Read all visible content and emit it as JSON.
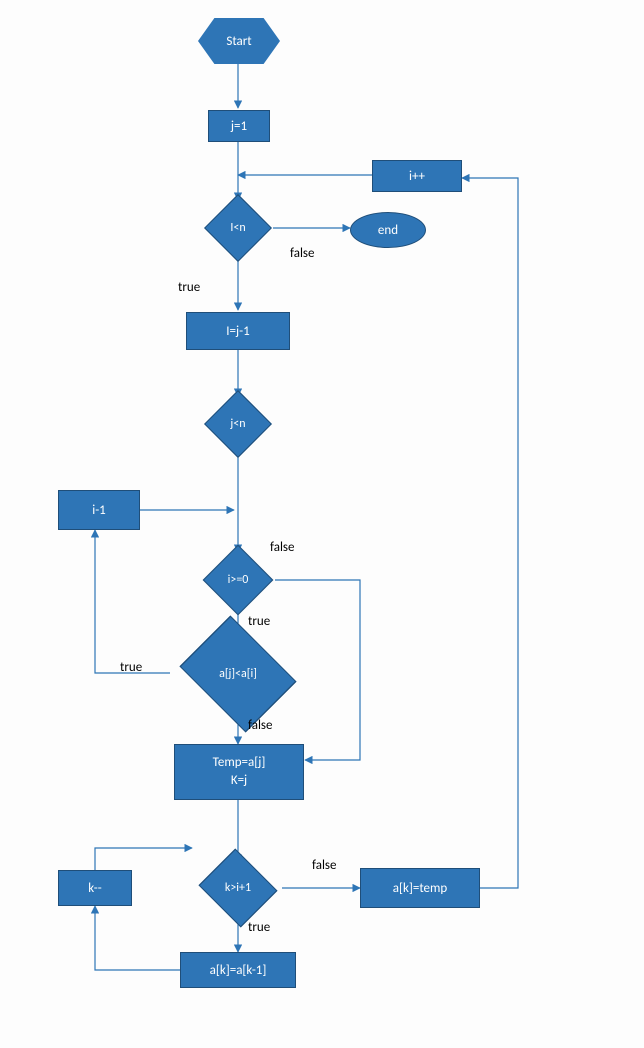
{
  "nodes": {
    "start": "Start",
    "init_j": "j=1",
    "inc_i": "i++",
    "cond_I_lt_n": "I<n",
    "end": "end",
    "set_I": "I=j-1",
    "cond_j_lt_n": "j<n",
    "i_minus_1": "i-1",
    "cond_i_ge_0": "i>=0",
    "cond_aj_lt_ai": "a[j]<a[i]",
    "temp_line1": "Temp=a[j]",
    "temp_line2": "K=j",
    "cond_k_gt_i1": "k>i+1",
    "ak_eq_temp": "a[k]=temp",
    "k_dec": "k--",
    "ak_eq_akm1": "a[k]=a[k-1]"
  },
  "labels": {
    "true": "true",
    "false": "false"
  }
}
